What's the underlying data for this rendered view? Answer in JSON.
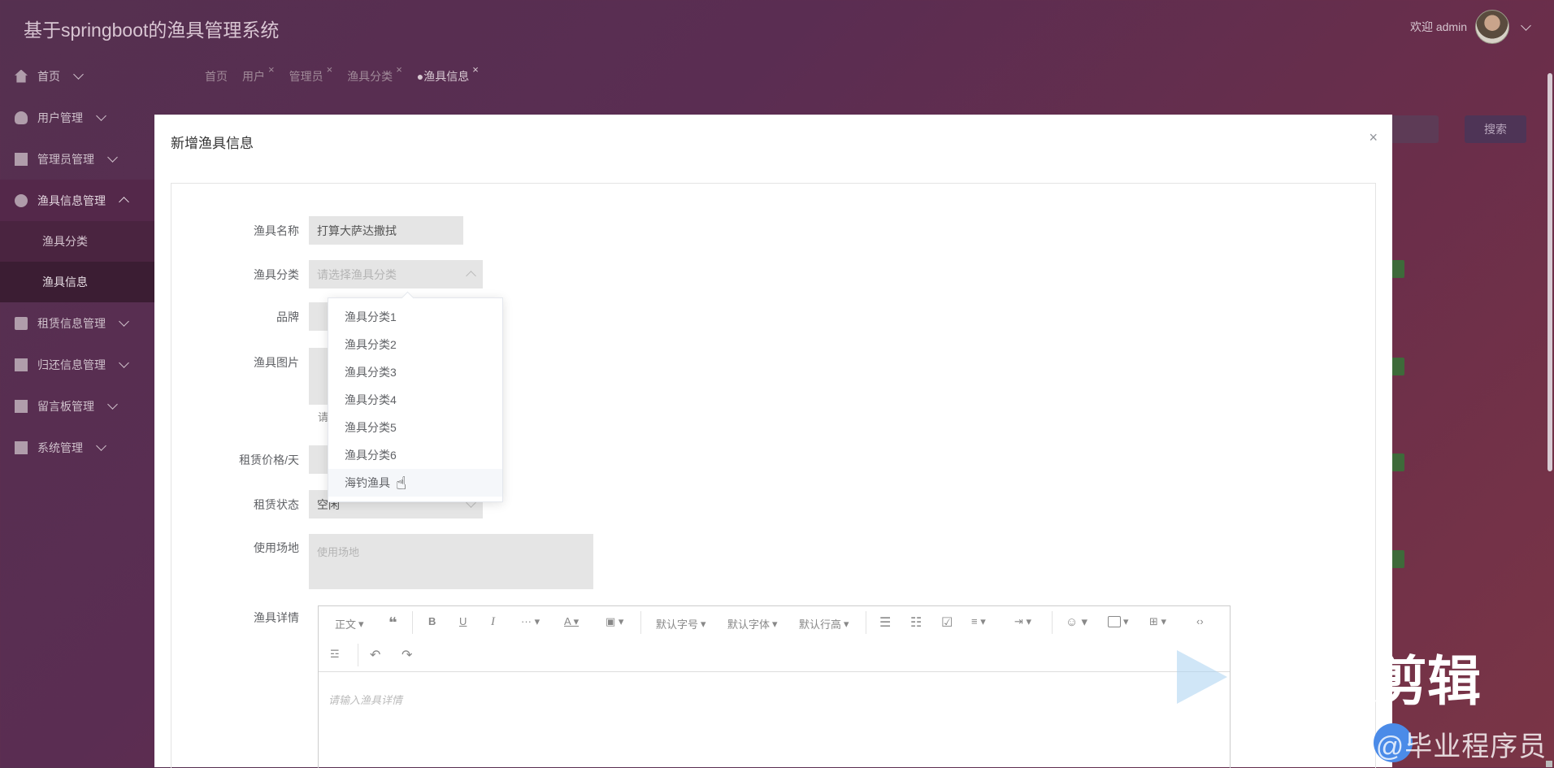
{
  "app": {
    "title": "基于springboot的渔具管理系统"
  },
  "user": {
    "greeting": "欢迎 admin"
  },
  "sidebar": {
    "items": [
      {
        "label": "首页",
        "icon": "home-icon"
      },
      {
        "label": "用户管理",
        "icon": "user-icon"
      },
      {
        "label": "管理员管理",
        "icon": "admin-icon"
      },
      {
        "label": "渔具信息管理",
        "icon": "check-circle-icon"
      },
      {
        "label": "租赁信息管理",
        "icon": "gift-icon"
      },
      {
        "label": "归还信息管理",
        "icon": "image-icon"
      },
      {
        "label": "留言板管理",
        "icon": "board-icon"
      },
      {
        "label": "系统管理",
        "icon": "system-icon"
      }
    ],
    "sub_items": [
      "渔具分类",
      "渔具信息"
    ]
  },
  "tabs": [
    {
      "label": "首页"
    },
    {
      "label": "用户"
    },
    {
      "label": "管理员"
    },
    {
      "label": "渔具分类"
    },
    {
      "label": "●渔具信息"
    }
  ],
  "background": {
    "search_label": "搜索"
  },
  "modal": {
    "title": "新增渔具信息",
    "close": "×",
    "fields": {
      "name_label": "渔具名称",
      "name_value": "打算大萨达撒拭",
      "category_label": "渔具分类",
      "category_placeholder": "请选择渔具分类",
      "brand_label": "品牌",
      "image_label": "渔具图片",
      "image_hint_partial": "请",
      "price_label": "租赁价格/天",
      "status_label": "租赁状态",
      "status_value": "空闲",
      "place_label": "使用场地",
      "place_placeholder": "使用场地",
      "detail_label": "渔具详情"
    },
    "dropdown_options": [
      "渔具分类1",
      "渔具分类2",
      "渔具分类3",
      "渔具分类4",
      "渔具分类5",
      "渔具分类6",
      "海钓渔具"
    ],
    "editor": {
      "paragraph": "正文",
      "font_size": "默认字号",
      "font_family": "默认字体",
      "line_height": "默认行高",
      "placeholder": "请输入渔具详情"
    }
  },
  "watermark": {
    "text": "CSDN @毕业程序员",
    "big": "剪辑"
  }
}
